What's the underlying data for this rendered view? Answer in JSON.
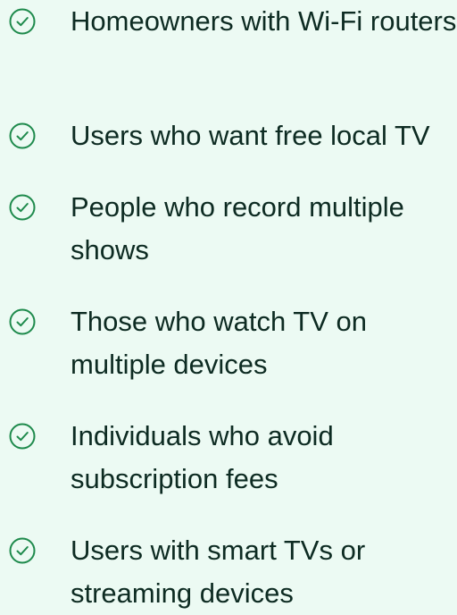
{
  "accent_color": "#1e8a4c",
  "checklist": {
    "icon": "check-circle-icon",
    "items": [
      {
        "label": "Homeowners with Wi-Fi routers"
      },
      {
        "label": "Users who want free local TV"
      },
      {
        "label": "People who record multiple shows"
      },
      {
        "label": "Those who watch TV on multiple devices"
      },
      {
        "label": "Individuals who avoid subscription fees"
      },
      {
        "label": "Users with smart TVs or streaming devices"
      }
    ]
  }
}
